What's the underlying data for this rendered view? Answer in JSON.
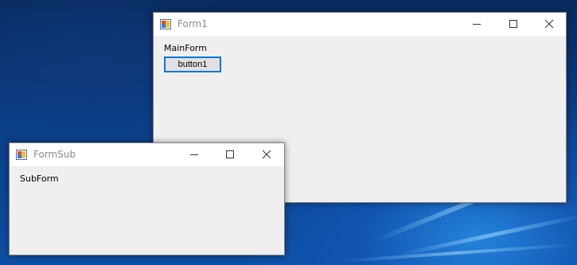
{
  "main_window": {
    "title": "Form1",
    "label": "MainForm",
    "button_label": "button1",
    "caption_buttons": [
      "minimize-icon",
      "maximize-icon",
      "close-icon"
    ]
  },
  "sub_window": {
    "title": "FormSub",
    "label": "SubForm",
    "caption_buttons": [
      "minimize-icon",
      "maximize-icon",
      "close-icon"
    ]
  },
  "colors": {
    "window_bg": "#efefef",
    "titlebar_bg": "#ffffff",
    "title_text": "#8a8a8a",
    "button_border_focus": "#0078d7",
    "button_bg": "#e1e1e1",
    "desktop_blue": "#0b3e86"
  }
}
